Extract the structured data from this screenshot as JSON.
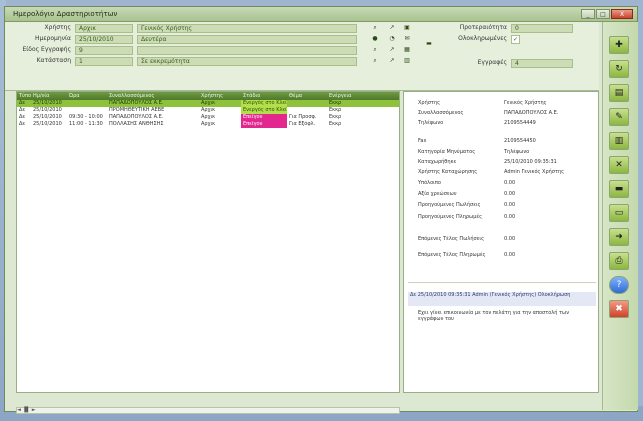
{
  "window": {
    "title": "Ημερολόγιο Δραστηριοτήτων",
    "buttons": [
      "_",
      "□",
      "X"
    ]
  },
  "form": {
    "user_label": "Χρήστης",
    "user_code": "Αρχικ",
    "user_name": "Γενικός Χρήστης",
    "date_label": "Ημερομηνία",
    "date_value": "25/10/2010",
    "date_text": "Δευτέρα",
    "type_label": "Είδος Εγγραφής",
    "type_value": "9",
    "status_label": "Κατάσταση",
    "status_code": "1",
    "status_text": "Σε εκκρεμότητα",
    "priority_label": "Προτεραιότητα",
    "priority_value": "0",
    "completed_label": "Ολοκληρωμένες",
    "completed_checked": true,
    "records_label": "Εγγραφές",
    "records_value": "4"
  },
  "grid": {
    "columns": [
      "Τύπος",
      "Ημ/νία",
      "Ώρα",
      "Συναλλασσόμενος",
      "Χρήστης",
      "Στάδιο",
      "Θέμα",
      "Ενέργεια"
    ],
    "rows": [
      {
        "cells": [
          "Δε",
          "25/10/2010",
          "",
          "ΠΑΠΑΔΟΠΟΥΛΟΣ Α.Ε.",
          "Αρχικ",
          "Ενεργός στο Κλείσιμο",
          "",
          "Εκκρ"
        ],
        "status": "green",
        "selected": true
      },
      {
        "cells": [
          "Δε",
          "25/10/2010",
          "",
          "ΠΡΟΜΗΘΕΥΤΙΚΗ ΑΕΒΕ",
          "Αρχικ",
          "Ενεργός στο Κλείσιμο",
          "",
          "Εκκρ"
        ],
        "status": "green",
        "selected": false
      },
      {
        "cells": [
          "Δε",
          "25/10/2010",
          "09:30 - 10:00",
          "ΠΑΠΑΔΟΠΟΥΛΟΣ Α.Ε.",
          "Αρχικ",
          "Επείγον",
          "Για Προσφ.",
          "Εκκρ"
        ],
        "status": "pink",
        "selected": false
      },
      {
        "cells": [
          "Δε",
          "25/10/2010",
          "11:00 - 11:30",
          "ΠΟΛΛΑΣΗΣ ΑΝΘΗΣΗΣ",
          "Αρχικ",
          "Επείγον",
          "Για Εξόφλ.",
          "Εκκρ"
        ],
        "status": "pink",
        "selected": false
      }
    ],
    "scroll_label": "◄ ▐▌ ►"
  },
  "detail": {
    "fields": [
      {
        "label": "Χρήστης",
        "value": "Γενικός Χρήστης"
      },
      {
        "label": "Συναλλασσόμενος",
        "value": "ΠΑΠΑΔΟΠΟΥΛΟΣ Α.Ε."
      },
      {
        "label": "Τηλέφωνο",
        "value": "2109554449"
      },
      {
        "label": "Fax",
        "value": "2109554450"
      },
      {
        "label": "Κατηγορία Μηνύματος",
        "value": "Τηλέφωνο"
      },
      {
        "label": "Καταχωρήθηκε",
        "value": "25/10/2010 09:35:31"
      },
      {
        "label": "Χρήστης Καταχώρησης",
        "value": "Admin Γενικός Χρήστης"
      },
      {
        "label": "Υπόλοιπο",
        "value": "0.00"
      },
      {
        "label": "Αξία χρεώσεων",
        "value": "0.00"
      },
      {
        "label": "Προηγούμενες Πωλήσεις",
        "value": "0.00"
      },
      {
        "label": "Προηγούμενες Πληρωμές",
        "value": "0.00"
      },
      {
        "label": "Επόμενες Τέλος Πωλήσεις",
        "value": "0.00"
      },
      {
        "label": "Επόμενες Τέλος Πληρωμές",
        "value": "0.00"
      }
    ],
    "note_head": "Δε 25/10/2010 09:35:31 Admin (Γενικός Χρήστης) Ολοκλήρωση",
    "note_body": "Εχει γίνει επικοινωνία με τον πελάτη για την αποστολή των εγγράφων του"
  },
  "toolbar": {
    "items": [
      {
        "icon": "new-icon",
        "symbol": "✚",
        "label": "Νέο"
      },
      {
        "icon": "refresh-icon",
        "symbol": "↻",
        "label": "Ανανέωση"
      },
      {
        "icon": "document-icon",
        "symbol": "▤",
        "label": "Έγγραφο"
      },
      {
        "icon": "document-edit-icon",
        "symbol": "✎",
        "label": "Επεξεργασία"
      },
      {
        "icon": "document-view-icon",
        "symbol": "▥",
        "label": "Προβολή"
      },
      {
        "icon": "document-delete-icon",
        "symbol": "✕",
        "label": "Διαγραφή"
      },
      {
        "icon": "folder-icon",
        "symbol": "▬",
        "label": "Φάκελος"
      },
      {
        "icon": "folder-open-icon",
        "symbol": "▭",
        "label": "Άνοιγμα"
      },
      {
        "icon": "export-icon",
        "symbol": "➜",
        "label": "Εξαγωγή"
      },
      {
        "icon": "print-icon",
        "symbol": "⎙",
        "label": "Εκτύπωση"
      },
      {
        "icon": "help-icon",
        "symbol": "?",
        "label": "Βοήθεια"
      },
      {
        "icon": "close-icon",
        "symbol": "✖",
        "label": "Κλείσιμο"
      }
    ]
  },
  "colors": {
    "accent": "#8ec23c",
    "pink_status": "#e2288e",
    "green_status": "#b3e04a"
  }
}
